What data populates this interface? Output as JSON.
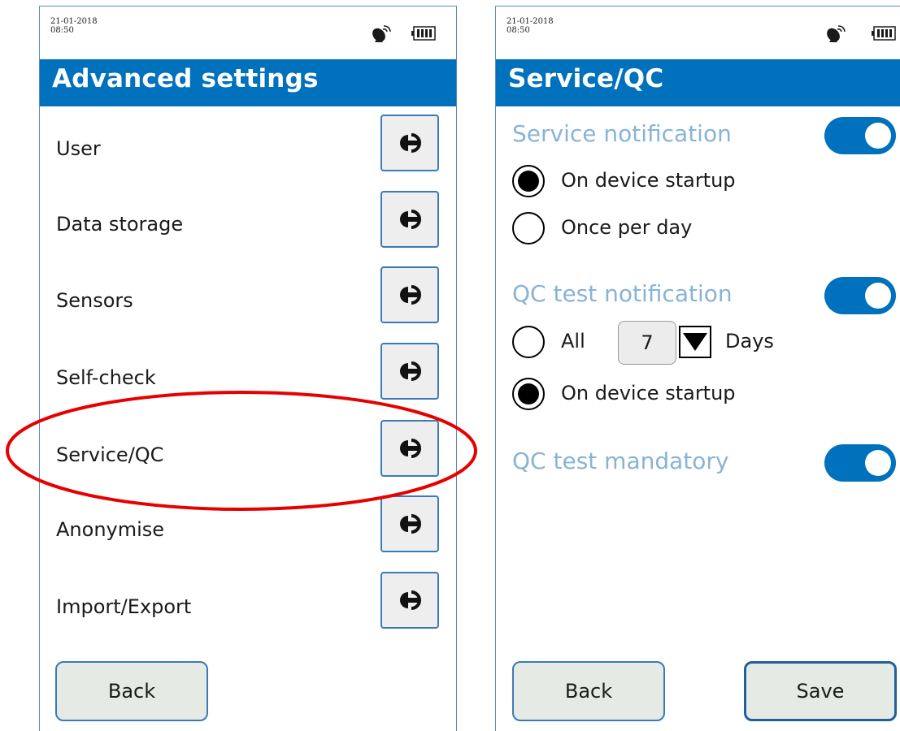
{
  "left_screen": {
    "status": {
      "date": "21-01-2018",
      "time": "08:50"
    },
    "title": "Advanced settings",
    "menu_items": [
      {
        "label": "User"
      },
      {
        "label": "Data storage"
      },
      {
        "label": "Sensors"
      },
      {
        "label": "Self-check"
      },
      {
        "label": "Service/QC"
      },
      {
        "label": "Anonymise"
      },
      {
        "label": "Import/Export"
      }
    ],
    "back_label": "Back"
  },
  "right_screen": {
    "status": {
      "date": "21-01-2018",
      "time": "08:50"
    },
    "title": "Service/QC",
    "service_notification": {
      "label": "Service notification",
      "enabled": true,
      "options": [
        "On device startup",
        "Once per day"
      ],
      "selected": "On device startup"
    },
    "qc_test_notification": {
      "label": "QC test notification",
      "enabled": true,
      "all_label": "All",
      "days_value": "7",
      "days_unit": "Days",
      "startup_label": "On device startup",
      "selected": "On device startup"
    },
    "qc_test_mandatory": {
      "label": "QC test mandatory",
      "enabled": true
    },
    "back_label": "Back",
    "save_label": "Save"
  },
  "colors": {
    "title_bar": "#0071bc",
    "section_label": "#89b3d6",
    "toggle_on": "#0071bc",
    "annotation_circle": "#e60000"
  },
  "icons": [
    "satellite-icon",
    "battery-icon",
    "arrow-right-icon",
    "dropdown-arrow-icon"
  ]
}
